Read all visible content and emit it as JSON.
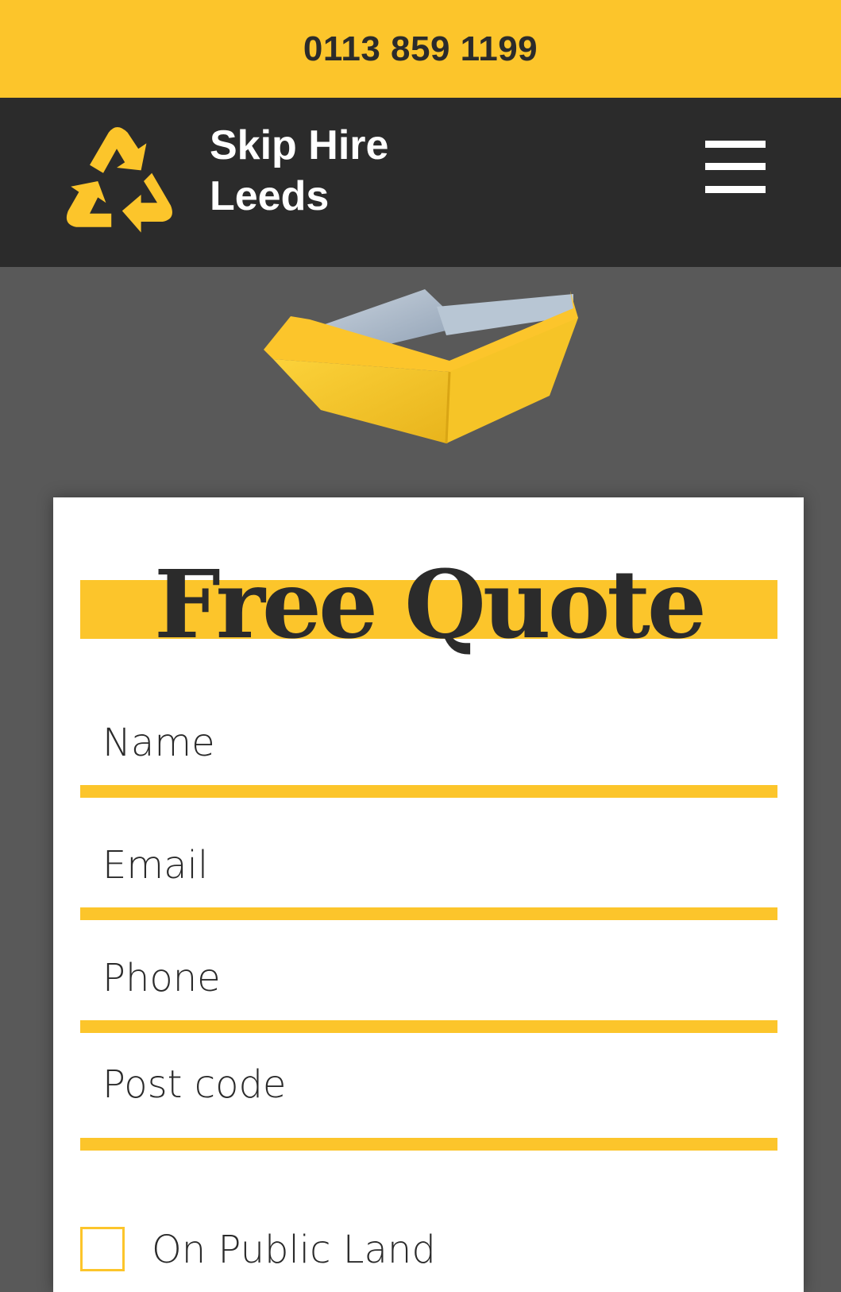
{
  "topbar": {
    "phone": "0113 859 1199"
  },
  "header": {
    "brand_line1": "Skip Hire",
    "brand_line2": "Leeds",
    "logo_icon": "recycle-icon",
    "menu_icon": "hamburger-menu-icon"
  },
  "hero": {
    "image_icon": "skip-container-illustration"
  },
  "form": {
    "title": "Free Quote",
    "fields": {
      "name": {
        "placeholder": "Name",
        "value": ""
      },
      "email": {
        "placeholder": "Email",
        "value": ""
      },
      "phone": {
        "placeholder": "Phone",
        "value": ""
      },
      "postcode": {
        "placeholder": "Post code",
        "value": ""
      }
    },
    "public_land_label": "On Public Land"
  },
  "colors": {
    "accent": "#fcc52b",
    "dark": "#2b2b2b",
    "background": "#595959"
  }
}
